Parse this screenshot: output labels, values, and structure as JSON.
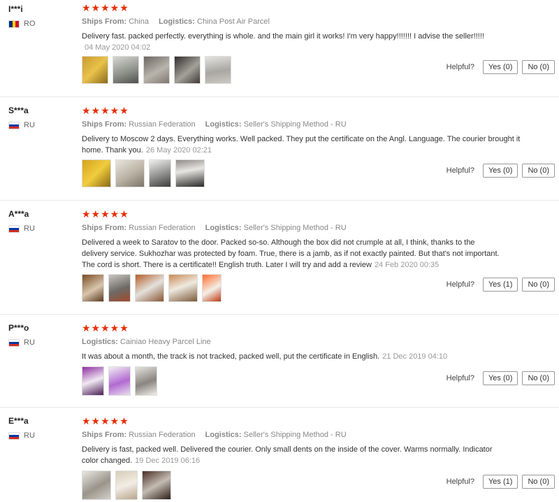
{
  "labels": {
    "ships_from": "Ships From:",
    "logistics": "Logistics:",
    "helpful": "Helpful?"
  },
  "stars": "★★★★★",
  "colors": {
    "star": "#e62e04",
    "border": "#e8e8e8"
  },
  "reviews": [
    {
      "user": "I***i",
      "country": "RO",
      "flag": "romania-flag-icon",
      "ships_from": "China",
      "logistics": "China Post Air Parcel",
      "text": "Delivery fast. packed perfectly. everything is whole. and the main girl it works! I'm very happy!!!!!!! I advise the seller!!!!!",
      "date": "04 May 2020 04:02",
      "photo_count": 5,
      "yes": "Yes (0)",
      "no": "No (0)"
    },
    {
      "user": "S***a",
      "country": "RU",
      "flag": "russia-flag-icon",
      "ships_from": "Russian Federation",
      "logistics": "Seller's Shipping Method - RU",
      "text": "Delivery to Moscow 2 days. Everything works. Well packed. They put the certificate on the Angl. Language. The courier brought it home. Thank you.",
      "date": "26 May 2020 02:21",
      "photo_count": 4,
      "yes": "Yes (0)",
      "no": "No (0)"
    },
    {
      "user": "A***a",
      "country": "RU",
      "flag": "russia-flag-icon",
      "ships_from": "Russian Federation",
      "logistics": "Seller's Shipping Method - RU",
      "text": "Delivered a week to Saratov to the door. Packed so-so. Although the box did not crumple at all, I think, thanks to the delivery service. Sukhozhar was protected by foam. True, there is a jamb, as if not exactly painted. But that's not important. The cord is short. There is a certificate!! English truth. Later I will try and add a review",
      "date": "24 Feb 2020 00:35",
      "photo_count": 5,
      "yes": "Yes (1)",
      "no": "No (0)"
    },
    {
      "user": "P***o",
      "country": "RU",
      "flag": "russia-flag-icon",
      "ships_from": "",
      "logistics": "Cainiao Heavy Parcel Line",
      "text": "It was about a month, the track is not tracked, packed well, put the certificate in English.",
      "date": "21 Dec 2019 04:10",
      "photo_count": 3,
      "yes": "Yes (0)",
      "no": "No (0)"
    },
    {
      "user": "E***a",
      "country": "RU",
      "flag": "russia-flag-icon",
      "ships_from": "Russian Federation",
      "logistics": "Seller's Shipping Method - RU",
      "text": "Delivery is fast, packed well. Delivered the courier. Only small dents on the inside of the cover. Warms normally. Indicator color changed.",
      "date": "19 Dec 2019 06:16",
      "photo_count": 3,
      "yes": "Yes (1)",
      "no": "No (0)"
    }
  ]
}
